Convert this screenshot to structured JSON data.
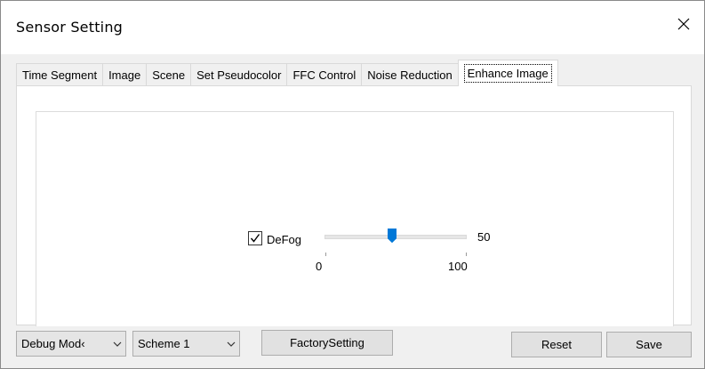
{
  "window": {
    "title": "Sensor Setting"
  },
  "tabs": [
    {
      "label": "Time Segment"
    },
    {
      "label": "Image"
    },
    {
      "label": "Scene"
    },
    {
      "label": "Set Pseudocolor"
    },
    {
      "label": "FFC Control"
    },
    {
      "label": "Noise Reduction"
    },
    {
      "label": "Enhance Image",
      "active": true
    }
  ],
  "enhance": {
    "defog": {
      "label": "DeFog",
      "checked": true,
      "value": "50",
      "min": "0",
      "max": "100",
      "value_fraction": 0.5
    }
  },
  "footer": {
    "mode_select": "Debug Mod‹",
    "scheme_select": "Scheme 1",
    "factory_label": "FactorySetting",
    "reset_label": "Reset",
    "save_label": "Save"
  },
  "colors": {
    "accent": "#0078d7"
  },
  "icons": {
    "close": "close-icon",
    "check": "check-icon",
    "dropdown": "chevron-down-icon"
  }
}
